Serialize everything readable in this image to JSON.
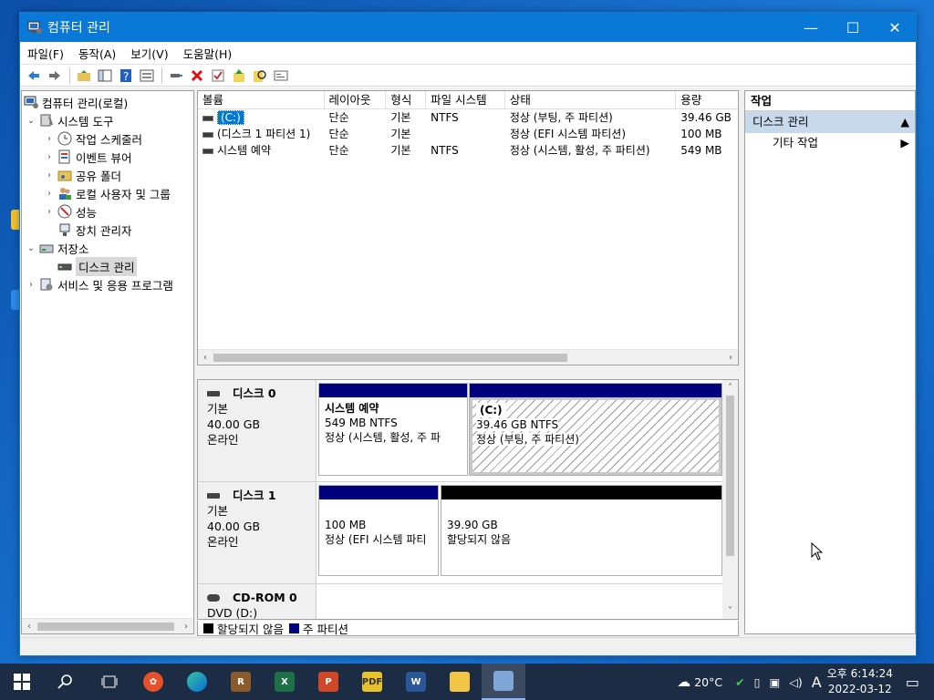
{
  "window": {
    "title": "컴퓨터 관리",
    "controls": {
      "minimize": "—",
      "maximize": "☐",
      "close": "✕"
    }
  },
  "menu": [
    "파일(F)",
    "동작(A)",
    "보기(V)",
    "도움말(H)"
  ],
  "toolbar_icons": [
    "back-arrow-icon",
    "forward-arrow-icon",
    "folder-up-icon",
    "show-tree-icon",
    "help-icon",
    "properties-view-icon",
    "connect-icon",
    "delete-icon",
    "check-icon",
    "export-icon",
    "search-icon",
    "rescan-icon"
  ],
  "tree": {
    "root": "컴퓨터 관리(로컬)",
    "system_tools": "시스템 도구",
    "task_scheduler": "작업 스케줄러",
    "event_viewer": "이벤트 뷰어",
    "shared_folders": "공유 폴더",
    "local_users": "로컬 사용자 및 그룹",
    "performance": "성능",
    "device_manager": "장치 관리자",
    "storage": "저장소",
    "disk_management": "디스크 관리",
    "services": "서비스 및 응용 프로그램"
  },
  "volume_list": {
    "headers": [
      "볼륨",
      "레이아웃",
      "형식",
      "파일 시스템",
      "상태",
      "용량"
    ],
    "rows": [
      {
        "volume": "(C:)",
        "layout": "단순",
        "type": "기본",
        "fs": "NTFS",
        "status": "정상 (부팅, 주 파티션)",
        "capacity": "39.46 GB"
      },
      {
        "volume": "(디스크 1 파티션 1)",
        "layout": "단순",
        "type": "기본",
        "fs": "",
        "status": "정상 (EFI 시스템 파티션)",
        "capacity": "100 MB"
      },
      {
        "volume": "시스템 예약",
        "layout": "단순",
        "type": "기본",
        "fs": "NTFS",
        "status": "정상 (시스템, 활성, 주 파티션)",
        "capacity": "549 MB"
      }
    ]
  },
  "disks": [
    {
      "name": "디스크 0",
      "kind": "기본",
      "size": "40.00 GB",
      "state": "온라인",
      "partitions": [
        {
          "title": "시스템 예약",
          "line1": "549 MB NTFS",
          "line2": "정상 (시스템, 활성, 주 파"
        },
        {
          "title": "(C:)",
          "line1": "39.46 GB NTFS",
          "line2": "정상 (부팅, 주 파티션)"
        }
      ]
    },
    {
      "name": "디스크 1",
      "kind": "기본",
      "size": "40.00 GB",
      "state": "온라인",
      "partitions": [
        {
          "title": "",
          "line1": "100 MB",
          "line2": "정상 (EFI 시스템 파티"
        },
        {
          "title": "",
          "line1": "39.90 GB",
          "line2": "할당되지 않음"
        }
      ]
    },
    {
      "name": "CD-ROM 0",
      "kind": "DVD (D:)"
    }
  ],
  "legend": {
    "unallocated": "할당되지 않음",
    "primary": "주 파티션"
  },
  "colors": {
    "primary": "#00007f",
    "unallocated": "#000000",
    "selection": "#0078d7",
    "titlebar": "#0a78d7"
  },
  "actions": {
    "header": "작업",
    "group": "디스크 관리",
    "item": "기타 작업"
  },
  "taskbar": {
    "apps": [
      "start-icon",
      "search-icon",
      "task-view-icon",
      "paint-app-icon",
      "edge-icon",
      "winrar-icon",
      "excel-icon",
      "powerpoint-icon",
      "pdf-icon",
      "word-icon",
      "file-explorer-icon",
      "computer-management-icon"
    ],
    "weather": "20°C",
    "ime": "A",
    "time": "오후 6:14:24",
    "date": "2022-03-12"
  }
}
